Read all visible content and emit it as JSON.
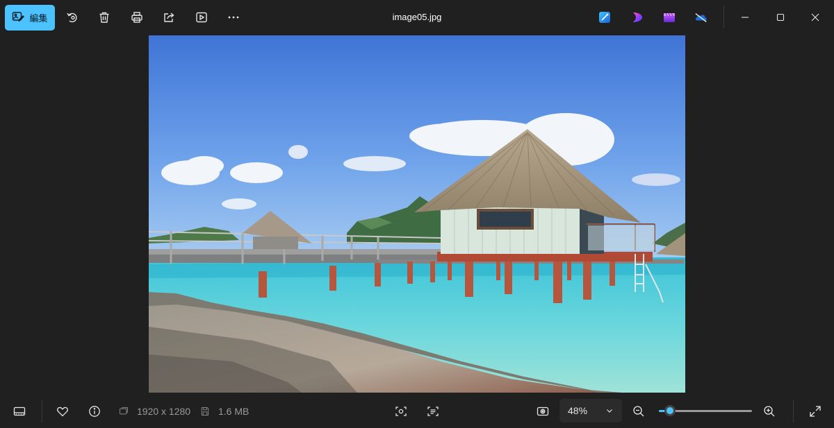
{
  "toolbar": {
    "edit_label": "編集",
    "icons": [
      "rotate-icon",
      "delete-icon",
      "print-icon",
      "share-icon",
      "slideshow-icon",
      "more-icon"
    ]
  },
  "window": {
    "title": "image05.jpg"
  },
  "apps": [
    "designer-icon",
    "clipchamp-purple-icon",
    "clipchamp-icon",
    "onedrive-icon"
  ],
  "photo": {
    "subject": "overwater-bungalow"
  },
  "bottom": {
    "dimensions": "1920 x 1280",
    "file_size": "1.6 MB",
    "zoom_value": "48%",
    "zoom_level": 0.12
  },
  "colors": {
    "accent": "#4cc2ff",
    "background": "#202020"
  }
}
